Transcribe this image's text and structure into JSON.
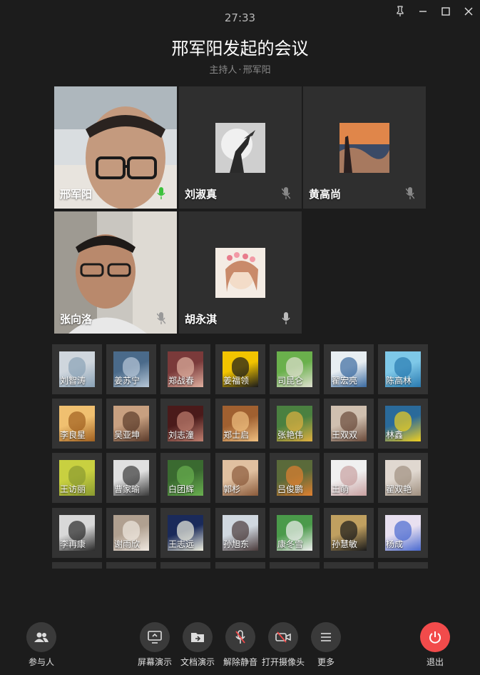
{
  "timer": "27:33",
  "meeting": {
    "title": "邢军阳发起的会议",
    "host_label": "主持人",
    "host_sep": "·",
    "host_name": "邢军阳"
  },
  "window_controls": [
    "pin-icon",
    "minimize-icon",
    "maximize-icon",
    "close-icon"
  ],
  "video_tiles": [
    {
      "name": "邢军阳",
      "mic": "active"
    },
    {
      "name": "刘淑真",
      "mic": "muted"
    },
    {
      "name": "黄高尚",
      "mic": "muted"
    },
    {
      "name": "张向洛",
      "mic": "muted"
    },
    {
      "name": "胡永淇",
      "mic": "on"
    }
  ],
  "participants": [
    "刘智涛",
    "姜苏宁",
    "郑战春",
    "姜福领",
    "司昆仑",
    "翟宏亮",
    "陈高林",
    "李良星",
    "吴亚坤",
    "刘志潼",
    "郑士启",
    "张艳伟",
    "王双双",
    "林鑫",
    "王访丽",
    "曹家瑜",
    "白团辉",
    "郭杉",
    "吕俊鹏",
    "王萌",
    "翟双艳",
    "李再康",
    "谢雨欣",
    "王志远",
    "孙旭东",
    "康冬雪",
    "孙慧敏",
    "杨成"
  ],
  "toolbar": {
    "participants": "参与人",
    "screen_share": "屏幕演示",
    "doc_share": "文档演示",
    "unmute": "解除静音",
    "camera": "打开摄像头",
    "more": "更多",
    "exit": "退出"
  },
  "colors": {
    "background": "#1c1c1c",
    "tile": "#2f2f2f",
    "exit": "#f24b4b",
    "mic_active": "#3cc13c"
  }
}
